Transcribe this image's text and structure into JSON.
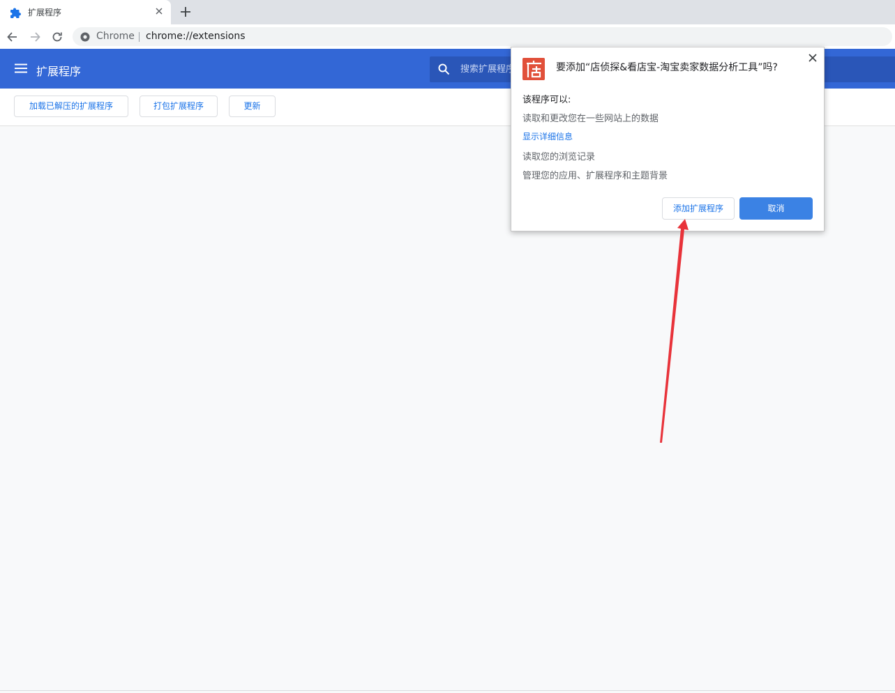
{
  "browser": {
    "tab": {
      "title": "扩展程序",
      "favicon": "puzzle-piece-icon"
    },
    "new_tab": "plus-icon",
    "omnibox": {
      "site_name": "Chrome",
      "url": "chrome://extensions"
    }
  },
  "header": {
    "title": "扩展程序",
    "search_placeholder": "搜索扩展程序"
  },
  "dev_toolbar": {
    "load_unpacked": "加载已解压的扩展程序",
    "pack": "打包扩展程序",
    "update": "更新"
  },
  "dialog": {
    "icon_char": "店",
    "title": "要添加“店侦探&看店宝-淘宝卖家数据分析工具”吗?",
    "heading": "该程序可以:",
    "permissions": [
      "读取和更改您在一些网站上的数据",
      "读取您的浏览记录",
      "管理您的应用、扩展程序和主题背景"
    ],
    "details_link": "显示详细信息",
    "add_label": "添加扩展程序",
    "cancel_label": "取消"
  },
  "colors": {
    "header_blue": "#3367d6",
    "link_blue": "#1a73e8",
    "cancel_blue": "#3b82e4",
    "icon_red": "#e1503a",
    "annotation_red": "#e8333a"
  }
}
